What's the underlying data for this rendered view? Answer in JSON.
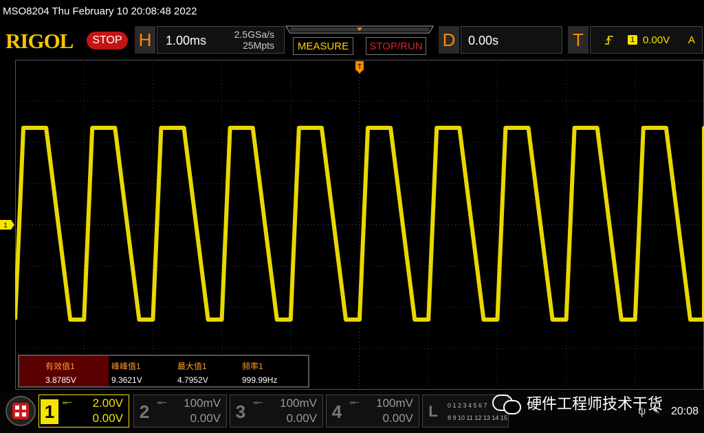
{
  "titlebar": {
    "text": "MSO8204  Thu February 10 20:08:48 2022"
  },
  "header": {
    "logo": "RIGOL",
    "run_state": "STOP",
    "horizontal": {
      "letter": "H",
      "timebase": "1.00ms",
      "sample_rate": "2.5GSa/s",
      "memory_depth": "25Mpts"
    },
    "measure_label": "MEASURE",
    "stoprun_label": "STOP/RUN",
    "delay": {
      "letter": "D",
      "value": "0.00s"
    },
    "trigger": {
      "letter": "T",
      "channel": "1",
      "level": "0.00V",
      "mode": "A"
    }
  },
  "colors": {
    "ch1": "#f5e400",
    "accent": "#ff8a00",
    "stop": "#c41414",
    "grid": "#3a3a3a"
  },
  "chart_data": {
    "type": "line",
    "title": "",
    "xlabel": "",
    "ylabel": "",
    "grid": true,
    "x_divisions": 10,
    "y_divisions": 8,
    "time_per_div_ms": 1.0,
    "volts_per_div": 2.0,
    "series": [
      {
        "channel": "1",
        "waveform": "trapezoid",
        "frequency_hz": 999.99,
        "high_v": 4.7,
        "low_v": -4.6,
        "first_rise_ms": 0.0,
        "rise_time_ms": 0.12,
        "high_duration_ms": 0.33,
        "fall_time_ms": 0.35
      }
    ],
    "ground_marker_label": "1",
    "trigger_marker_label": "T"
  },
  "measurements": [
    {
      "name": "有效值1",
      "value": "3.8785V"
    },
    {
      "name": "峰峰值1",
      "value": "9.3621V"
    },
    {
      "name": "最大值1",
      "value": "4.7952V"
    },
    {
      "name": "频率1",
      "value": "999.99Hz"
    }
  ],
  "channels": [
    {
      "num": "1",
      "scale": "2.00V",
      "offset": "0.00V",
      "active": true
    },
    {
      "num": "2",
      "scale": "100mV",
      "offset": "0.00V",
      "active": false
    },
    {
      "num": "3",
      "scale": "100mV",
      "offset": "0.00V",
      "active": false
    },
    {
      "num": "4",
      "scale": "100mV",
      "offset": "0.00V",
      "active": false
    }
  ],
  "logic": {
    "letter": "L",
    "row1": "0 1 2 3  4 5 6 7",
    "row2": "8 9 10 11 12 13 14 15"
  },
  "watermark": "硬件工程师技术干货",
  "clock": "20:08"
}
